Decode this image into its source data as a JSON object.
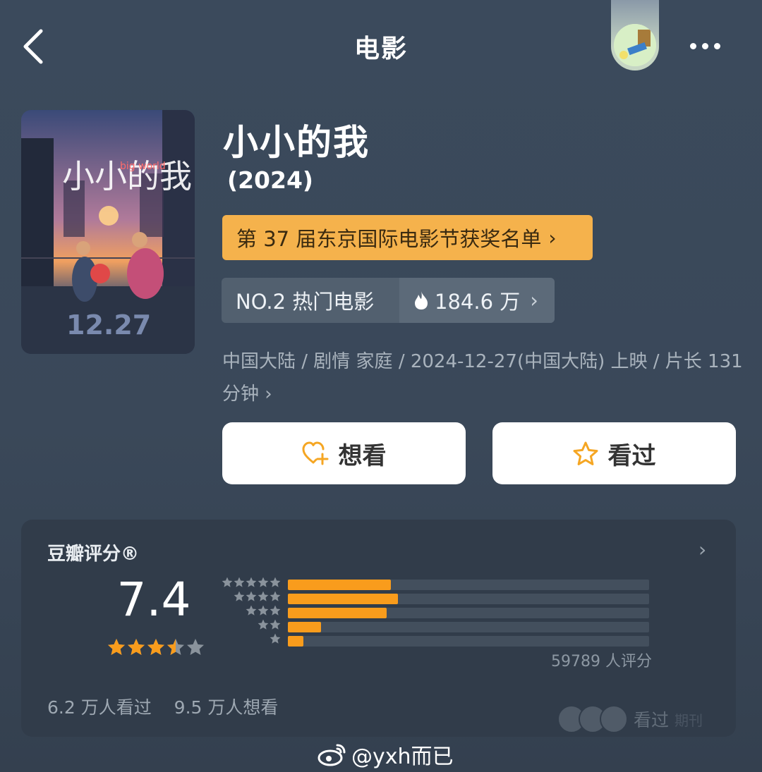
{
  "header": {
    "title": "电影",
    "back_icon": "back-chevron-icon",
    "more_icon": "more-dots-icon"
  },
  "movie": {
    "title": "小小的我",
    "year": "(2024)",
    "award_label": "第 37 届东京国际电影节获奖名单",
    "rank_label": "NO.2 热门电影",
    "heat_value": "184.6 万",
    "info": "中国大陆 / 剧情 家庭 / 2024-12-27(中国大陆) 上映 / 片长 131分钟",
    "poster": {
      "title": "小小的我",
      "subtitle": "big world",
      "date": "12.27"
    }
  },
  "actions": {
    "want_label": "想看",
    "seen_label": "看过"
  },
  "rating": {
    "label": "豆瓣评分®",
    "score": "7.4",
    "stars": 3.5,
    "distribution": [
      {
        "stars": 5,
        "fraction": 0.285
      },
      {
        "stars": 4,
        "fraction": 0.305
      },
      {
        "stars": 3,
        "fraction": 0.273
      },
      {
        "stars": 2,
        "fraction": 0.092
      },
      {
        "stars": 1,
        "fraction": 0.042
      }
    ],
    "vote_count": "59789 人评分",
    "seen_count": "6.2 万人看过",
    "want_count": "9.5 万人想看",
    "friends_label": "看过",
    "friends_sub": "期刊"
  },
  "watermark": "@yxh而已",
  "colors": {
    "accent": "#f99c1c",
    "award_bg": "#f5b24c",
    "background": "#3b4a5c",
    "card": "#313c4a"
  }
}
